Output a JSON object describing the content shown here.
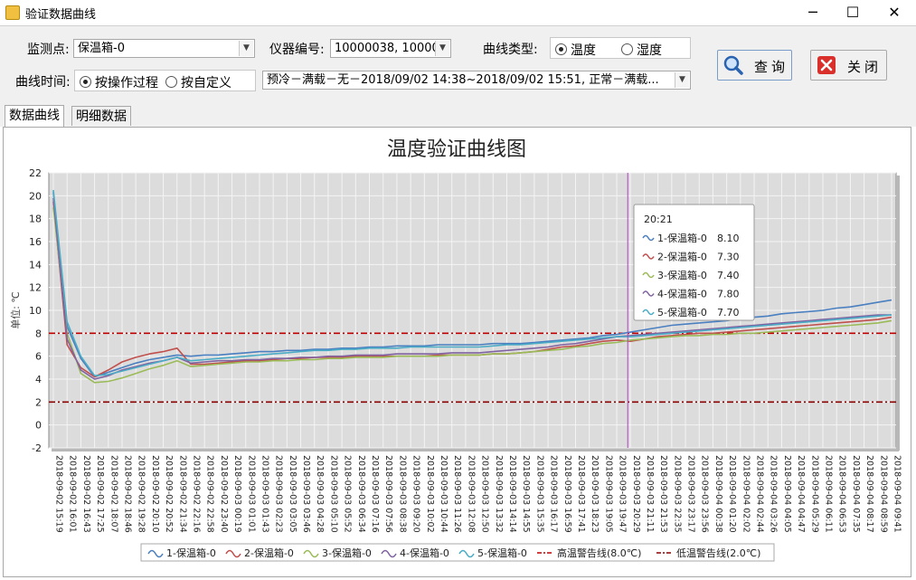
{
  "window": {
    "title": "验证数据曲线",
    "minimize": "─",
    "maximize": "☐",
    "close": "✕"
  },
  "toolbar": {
    "monitor_label": "监测点:",
    "monitor_value": "保温箱-0",
    "instrument_label": "仪器编号:",
    "instrument_value": "10000038, 10000...",
    "curve_type_label": "曲线类型:",
    "curve_type_options": [
      "温度",
      "湿度"
    ],
    "curve_type_selected": "温度",
    "curve_time_label": "曲线时间:",
    "curve_time_options": [
      "按操作过程",
      "按自定义"
    ],
    "curve_time_selected": "按操作过程",
    "process_value": "预冷－满载－无－2018/09/02 14:38~2018/09/02 15:51, 正常－满载...",
    "query_label": "查询",
    "close_label": "关闭"
  },
  "tabs": [
    "数据曲线",
    "明细数据"
  ],
  "chart_data": {
    "type": "line",
    "title": "温度验证曲线图",
    "ylabel": "单位: ℃",
    "ylim": [
      -2,
      22
    ],
    "yticks": [
      -2,
      0,
      2,
      4,
      6,
      8,
      10,
      12,
      14,
      16,
      18,
      20,
      22
    ],
    "grid": true,
    "legend_position": "bottom",
    "x": [
      "2018-09-02 15:19",
      "2018-09-02 16:01",
      "2018-09-02 16:43",
      "2018-09-02 17:25",
      "2018-09-02 18:07",
      "2018-09-02 18:46",
      "2018-09-02 19:28",
      "2018-09-02 20:10",
      "2018-09-02 20:52",
      "2018-09-02 21:34",
      "2018-09-02 22:16",
      "2018-09-02 22:58",
      "2018-09-02 23:40",
      "2018-09-03 00:19",
      "2018-09-03 01:01",
      "2018-09-03 01:43",
      "2018-09-03 02:23",
      "2018-09-03 03:05",
      "2018-09-03 03:46",
      "2018-09-03 04:28",
      "2018-09-03 05:10",
      "2018-09-03 05:52",
      "2018-09-03 06:34",
      "2018-09-03 07:16",
      "2018-09-03 07:56",
      "2018-09-03 08:38",
      "2018-09-03 09:20",
      "2018-09-03 10:02",
      "2018-09-03 10:44",
      "2018-09-03 11:26",
      "2018-09-03 12:08",
      "2018-09-03 12:50",
      "2018-09-03 13:32",
      "2018-09-03 14:14",
      "2018-09-03 14:55",
      "2018-09-03 15:35",
      "2018-09-03 16:17",
      "2018-09-03 16:59",
      "2018-09-03 17:41",
      "2018-09-03 18:23",
      "2018-09-03 19:05",
      "2018-09-03 19:47",
      "2018-09-03 20:29",
      "2018-09-03 21:11",
      "2018-09-03 21:53",
      "2018-09-03 22:35",
      "2018-09-03 23:17",
      "2018-09-03 23:56",
      "2018-09-04 00:38",
      "2018-09-04 01:20",
      "2018-09-04 02:02",
      "2018-09-04 02:44",
      "2018-09-04 03:26",
      "2018-09-04 04:05",
      "2018-09-04 04:47",
      "2018-09-04 05:29",
      "2018-09-04 06:11",
      "2018-09-04 06:53",
      "2018-09-04 07:35",
      "2018-09-04 08:17",
      "2018-09-04 08:59",
      "2018-09-04 09:41"
    ],
    "series": [
      {
        "name": "1-保温箱-0",
        "color": "#4a7fc0",
        "values": [
          20.3,
          8.6,
          5.8,
          4.2,
          4.6,
          5.0,
          5.4,
          5.7,
          5.9,
          6.1,
          6.0,
          6.1,
          6.1,
          6.2,
          6.3,
          6.4,
          6.4,
          6.5,
          6.5,
          6.6,
          6.6,
          6.7,
          6.7,
          6.8,
          6.8,
          6.9,
          6.9,
          6.9,
          7.0,
          7.0,
          7.0,
          7.0,
          7.1,
          7.1,
          7.1,
          7.2,
          7.3,
          7.4,
          7.5,
          7.6,
          7.8,
          7.9,
          8.1,
          8.3,
          8.5,
          8.7,
          8.8,
          8.9,
          9.0,
          9.1,
          9.3,
          9.4,
          9.5,
          9.7,
          9.8,
          9.9,
          10.0,
          10.2,
          10.3,
          10.5,
          10.7,
          10.9
        ]
      },
      {
        "name": "2-保温箱-0",
        "color": "#c0504d",
        "values": [
          19.5,
          7.0,
          5.0,
          4.2,
          4.8,
          5.5,
          5.9,
          6.2,
          6.4,
          6.7,
          5.3,
          5.3,
          5.4,
          5.5,
          5.6,
          5.6,
          5.7,
          5.8,
          5.8,
          5.9,
          5.9,
          5.9,
          6.0,
          6.0,
          6.0,
          6.0,
          6.0,
          6.0,
          6.1,
          6.1,
          6.1,
          6.1,
          6.2,
          6.2,
          6.3,
          6.4,
          6.6,
          6.8,
          6.9,
          7.1,
          7.3,
          7.4,
          7.3,
          7.5,
          7.7,
          7.8,
          7.9,
          8.0,
          8.0,
          8.1,
          8.2,
          8.3,
          8.4,
          8.5,
          8.6,
          8.7,
          8.8,
          8.9,
          9.0,
          9.1,
          9.2,
          9.4
        ]
      },
      {
        "name": "3-保温箱-0",
        "color": "#9bbb59",
        "values": [
          19.0,
          8.0,
          4.5,
          3.7,
          3.8,
          4.1,
          4.5,
          4.9,
          5.2,
          5.6,
          5.1,
          5.2,
          5.3,
          5.4,
          5.5,
          5.5,
          5.6,
          5.6,
          5.7,
          5.7,
          5.8,
          5.8,
          5.9,
          5.9,
          5.9,
          6.0,
          6.0,
          6.0,
          6.0,
          6.1,
          6.1,
          6.1,
          6.2,
          6.2,
          6.3,
          6.4,
          6.5,
          6.6,
          6.8,
          6.9,
          7.1,
          7.2,
          7.4,
          7.5,
          7.6,
          7.7,
          7.8,
          7.8,
          7.9,
          7.9,
          8.0,
          8.0,
          8.1,
          8.2,
          8.3,
          8.4,
          8.5,
          8.6,
          8.7,
          8.8,
          8.9,
          9.1
        ]
      },
      {
        "name": "4-保温箱-0",
        "color": "#8064a2",
        "values": [
          19.8,
          7.5,
          4.8,
          4.0,
          4.3,
          4.8,
          5.1,
          5.4,
          5.6,
          5.9,
          5.4,
          5.5,
          5.6,
          5.6,
          5.7,
          5.7,
          5.8,
          5.8,
          5.9,
          5.9,
          6.0,
          6.0,
          6.1,
          6.1,
          6.1,
          6.2,
          6.2,
          6.2,
          6.2,
          6.3,
          6.3,
          6.3,
          6.4,
          6.5,
          6.6,
          6.7,
          6.8,
          7.0,
          7.1,
          7.3,
          7.5,
          7.7,
          7.8,
          7.9,
          8.0,
          8.1,
          8.2,
          8.3,
          8.4,
          8.5,
          8.6,
          8.7,
          8.8,
          8.9,
          9.0,
          9.1,
          9.2,
          9.3,
          9.4,
          9.5,
          9.6,
          9.6
        ]
      },
      {
        "name": "5-保温箱-0",
        "color": "#4bacc6",
        "values": [
          20.5,
          9.0,
          6.0,
          4.3,
          4.4,
          4.7,
          5.0,
          5.3,
          5.6,
          5.9,
          5.6,
          5.7,
          5.8,
          5.9,
          6.0,
          6.1,
          6.2,
          6.3,
          6.4,
          6.5,
          6.5,
          6.6,
          6.6,
          6.7,
          6.7,
          6.7,
          6.8,
          6.8,
          6.8,
          6.8,
          6.8,
          6.8,
          6.9,
          7.0,
          7.0,
          7.1,
          7.2,
          7.3,
          7.4,
          7.5,
          7.6,
          7.7,
          7.7,
          7.8,
          7.9,
          8.0,
          8.1,
          8.2,
          8.3,
          8.4,
          8.5,
          8.6,
          8.7,
          8.8,
          8.9,
          9.0,
          9.1,
          9.2,
          9.3,
          9.4,
          9.5,
          9.6
        ]
      }
    ],
    "threshold_lines": [
      {
        "name": "高温警告线(8.0℃)",
        "value": 8.0,
        "color": "#c00000"
      },
      {
        "name": "低温警告线(2.0℃)",
        "value": 2.0,
        "color": "#8b0000"
      }
    ],
    "cursor": {
      "x": "2018-09-03 20:21",
      "label": "20:21",
      "entries": [
        {
          "name": "1-保温箱-0",
          "value": "8.10",
          "color": "#4a7fc0"
        },
        {
          "name": "2-保温箱-0",
          "value": "7.30",
          "color": "#c0504d"
        },
        {
          "name": "3-保温箱-0",
          "value": "7.40",
          "color": "#9bbb59"
        },
        {
          "name": "4-保温箱-0",
          "value": "7.80",
          "color": "#8064a2"
        },
        {
          "name": "5-保温箱-0",
          "value": "7.70",
          "color": "#4bacc6"
        }
      ]
    }
  }
}
